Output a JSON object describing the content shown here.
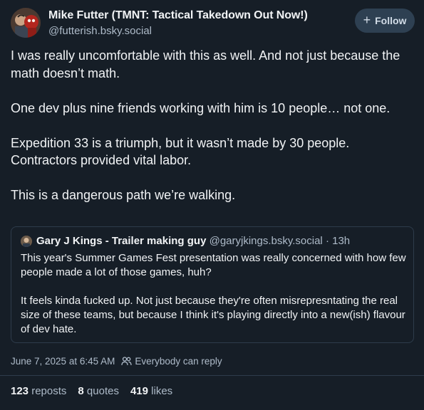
{
  "author": {
    "display_name": "Mike Futter (TMNT: Tactical Takedown Out Now!)",
    "handle": "@futterish.bsky.social"
  },
  "follow_button": {
    "label": "Follow",
    "icon": "plus-icon"
  },
  "post": {
    "paragraphs": [
      "I was really uncomfortable with this as well. And not just because the math doesn’t math.",
      "One dev plus nine friends working with him is 10 people… not one.",
      "Expedition 33 is a triumph, but it wasn’t made by 30 people. Contractors provided vital labor.",
      "This is a dangerous path we’re walking."
    ]
  },
  "quote": {
    "display_name": "Gary J Kings - Trailer making guy",
    "handle": "@garyjkings.bsky.social",
    "separator": "·",
    "time": "13h",
    "paragraphs": [
      "This year's Summer Games Fest presentation was really concerned with how few people made a lot of those games, huh?",
      "It feels kinda fucked up. Not just because they're often misrepresntating the real size of these teams, but because I think it's playing directly into a new(ish) flavour of dev hate."
    ]
  },
  "meta": {
    "timestamp": "June 7, 2025 at 6:45 AM",
    "reply_setting": "Everybody can reply",
    "reply_icon": "people-icon"
  },
  "stats": {
    "reposts_count": "123",
    "reposts_label": "reposts",
    "quotes_count": "8",
    "quotes_label": "quotes",
    "likes_count": "419",
    "likes_label": "likes"
  },
  "colors": {
    "background": "#161e27",
    "text": "#f1f3f5",
    "muted": "#aebbc9",
    "border": "#2e3c4b",
    "follow_bg": "#2e4052"
  }
}
